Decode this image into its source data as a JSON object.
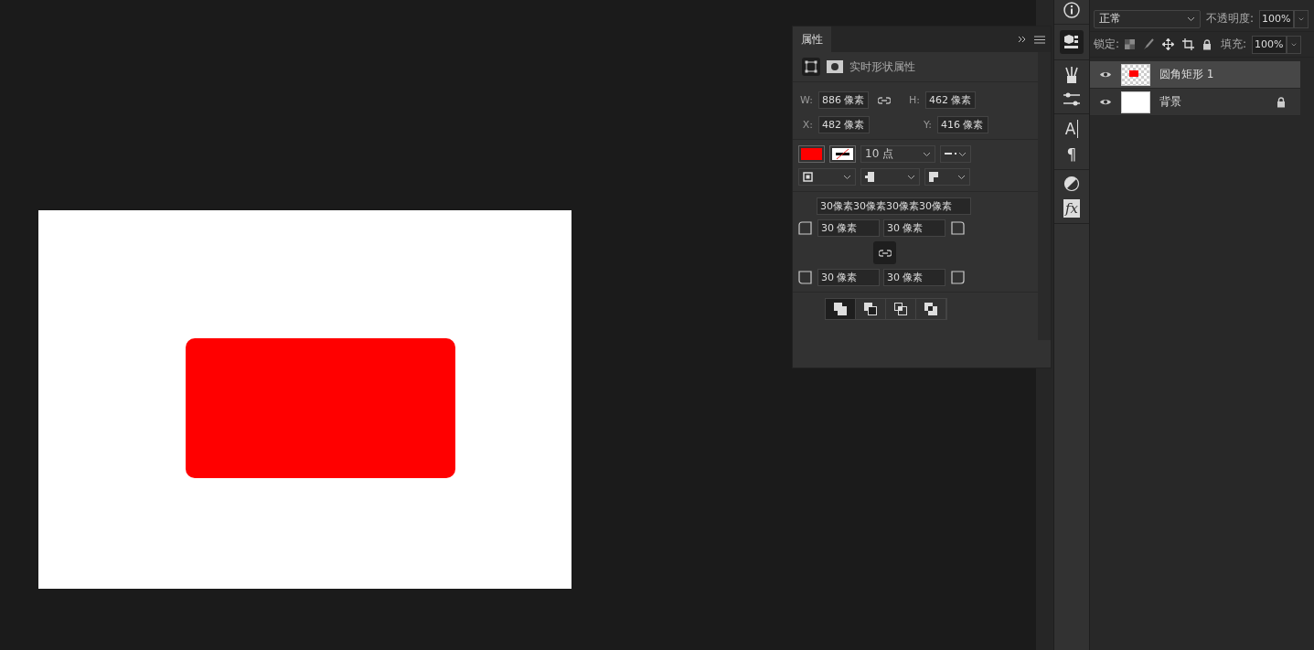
{
  "properties_panel": {
    "tab": "属性",
    "subtitle": "实时形状属性",
    "w_label": "W:",
    "w": "886 像素",
    "h_label": "H:",
    "h": "462 像素",
    "x_label": "X:",
    "x": "482 像素",
    "y_label": "Y:",
    "y": "416 像素",
    "stroke_width": "10 点",
    "all_corners": "30像素30像素30像素30像素",
    "corners": [
      "30 像素",
      "30 像素",
      "30 像素",
      "30 像素"
    ]
  },
  "tool_strip": {
    "character_glyph": "A",
    "paragraph_glyph": "¶",
    "styles_glyph": "fx"
  },
  "layers_panel": {
    "blend_mode": "正常",
    "opacity_label": "不透明度:",
    "opacity": "100%",
    "lock_label": "锁定:",
    "fill_label": "填充:",
    "fill": "100%",
    "layers": [
      {
        "name": "圆角矩形 1",
        "selected": true,
        "visible": true,
        "locked": false,
        "kind": "shape"
      },
      {
        "name": "背景",
        "selected": false,
        "visible": true,
        "locked": true,
        "kind": "background"
      }
    ]
  }
}
